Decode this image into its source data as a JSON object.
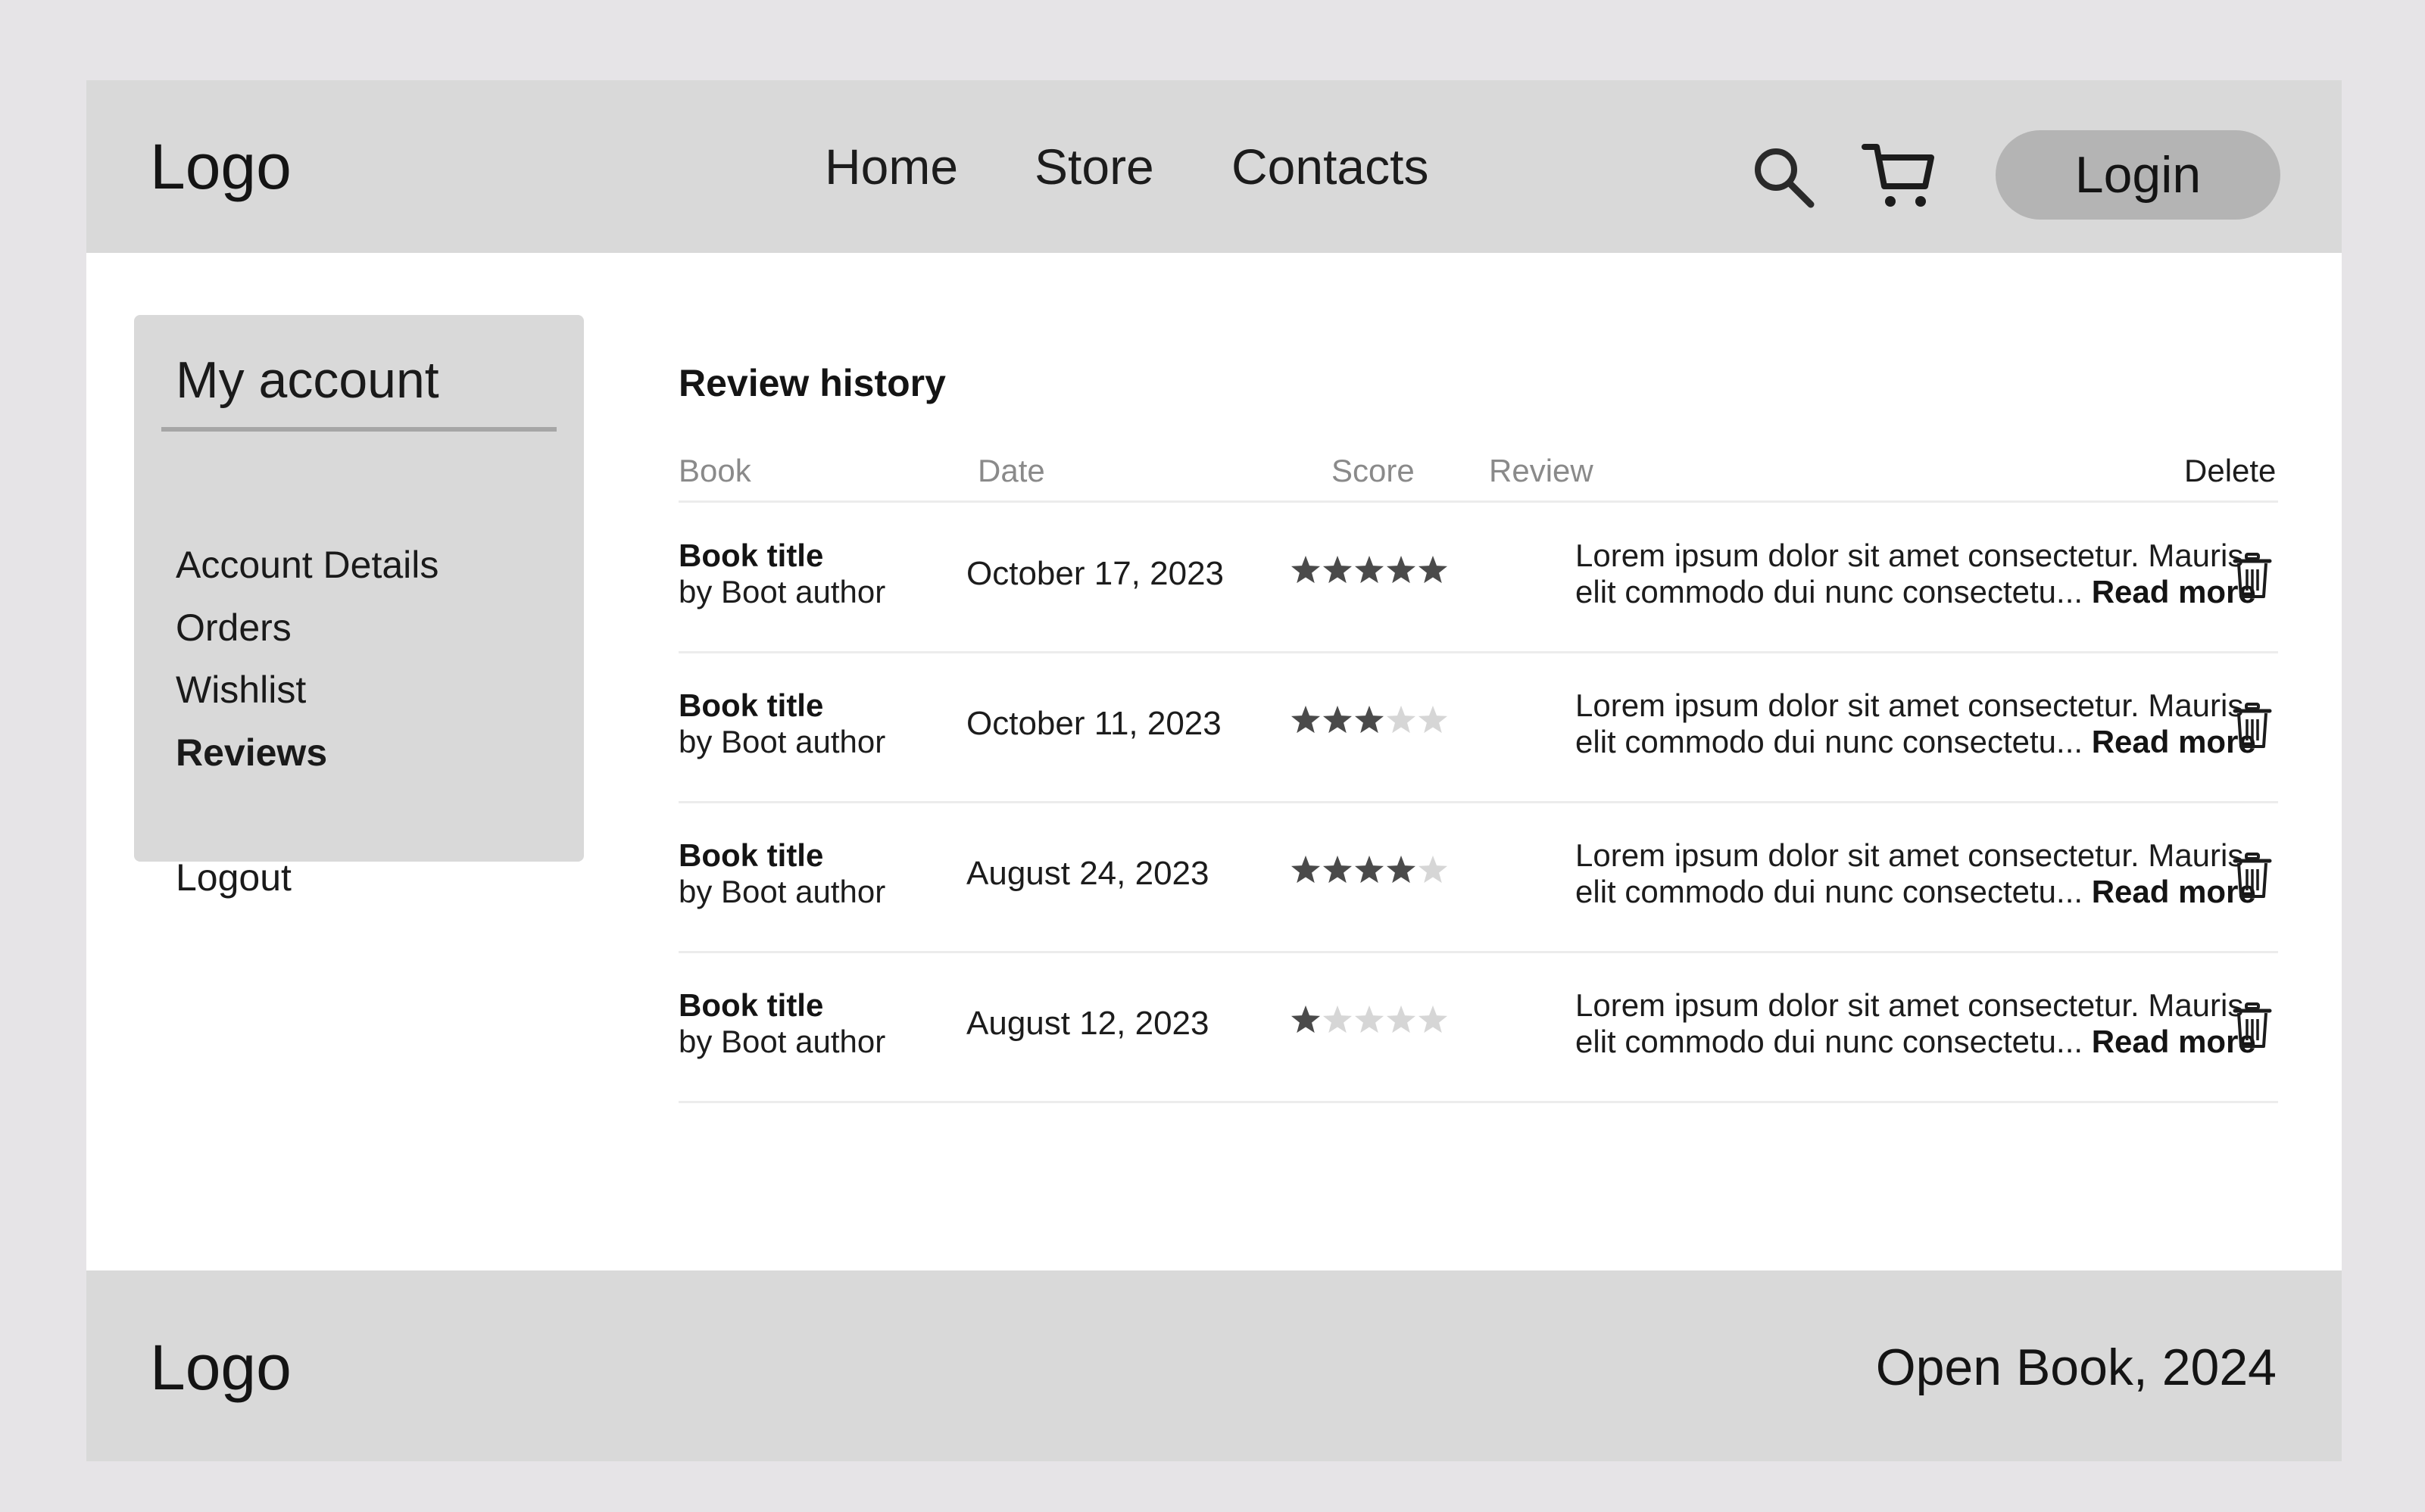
{
  "header": {
    "logo": "Logo",
    "nav": [
      "Home",
      "Store",
      "Contacts"
    ],
    "icons": [
      "search-icon",
      "cart-icon"
    ],
    "login_label": "Login"
  },
  "sidebar": {
    "title": "My account",
    "items": [
      "Account Details",
      "Orders",
      "Wishlist",
      "Reviews"
    ],
    "active_item": "Reviews",
    "logout": "Logout"
  },
  "main": {
    "title": "Review history",
    "columns": [
      "Book",
      "Date",
      "Score",
      "Review",
      "Delete"
    ],
    "read_more_label": "Read more",
    "rows": [
      {
        "title": "Book title",
        "author": "by Boot author",
        "date": "October 17, 2023",
        "score": 5,
        "review_line1": "Lorem ipsum dolor sit amet consectetur. Mauris",
        "review_line2": "elit commodo dui nunc consectetu..."
      },
      {
        "title": "Book title",
        "author": "by Boot author",
        "date": "October 11, 2023",
        "score": 3,
        "review_line1": "Lorem ipsum dolor sit amet consectetur. Mauris",
        "review_line2": "elit commodo dui nunc consectetu..."
      },
      {
        "title": "Book title",
        "author": "by Boot author",
        "date": "August 24, 2023",
        "score": 4,
        "review_line1": "Lorem ipsum dolor sit amet consectetur. Mauris",
        "review_line2": "elit commodo dui nunc consectetu..."
      },
      {
        "title": "Book title",
        "author": "by Boot author",
        "date": "August 12, 2023",
        "score": 1,
        "review_line1": "Lorem ipsum dolor sit amet consectetur. Mauris",
        "review_line2": "elit commodo dui nunc consectetu..."
      }
    ],
    "star_max": 5
  },
  "footer": {
    "logo": "Logo",
    "copyright": "Open Book, 2024"
  },
  "colors": {
    "page_bg": "#e6e4e7",
    "panel_bg": "#d9d9d9",
    "button_bg": "#b4b4b4",
    "star_filled": "#4a4a4a",
    "star_empty": "#d6d6d6"
  }
}
